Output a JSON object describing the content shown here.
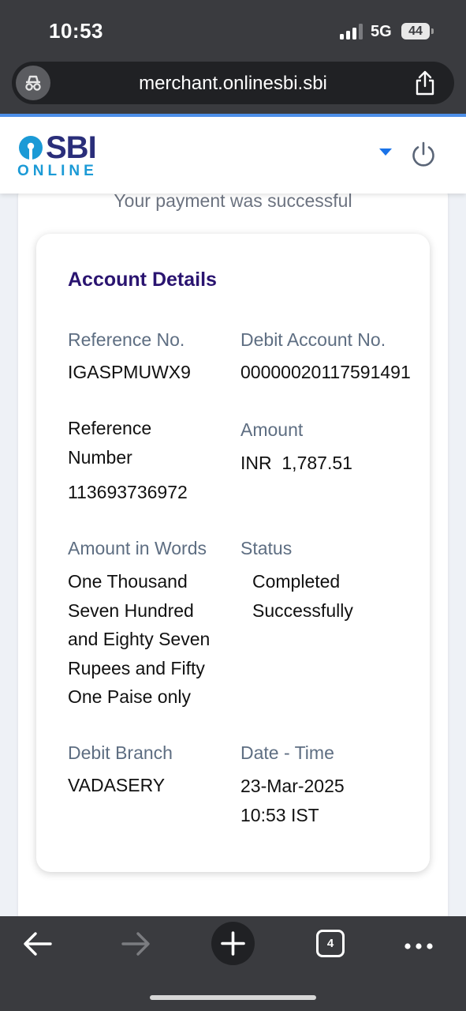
{
  "status_bar": {
    "time": "10:53",
    "network": "5G",
    "battery": "44"
  },
  "browser": {
    "url": "merchant.onlinesbi.sbi",
    "tab_count": "4"
  },
  "site_header": {
    "brand": "SBI",
    "brand_sub": "ONLINE"
  },
  "page": {
    "success_message": "Your payment was successful"
  },
  "account_details": {
    "title": "Account Details",
    "reference_no_label": "Reference No.",
    "reference_no_value": "IGASPMUWX9",
    "debit_account_label": "Debit Account No.",
    "debit_account_value": "00000020117591491",
    "reference_number_label_line1": "Reference",
    "reference_number_label_line2": "Number",
    "reference_number_value": "113693736972",
    "amount_label": "Amount",
    "amount_value": "INR  1,787.51",
    "amount_words_label": "Amount in Words",
    "amount_words_lines": [
      "One Thousand",
      "Seven Hundred",
      "and Eighty Seven",
      "Rupees and Fifty",
      "One Paise only"
    ],
    "status_label": "Status",
    "status_lines": [
      "Completed",
      "Successfully"
    ],
    "debit_branch_label": "Debit Branch",
    "debit_branch_value": "VADASERY",
    "date_time_label": "Date - Time",
    "date_time_lines": [
      "23-Mar-2025",
      "10:53 IST"
    ]
  },
  "colors": {
    "title": "#2a1470",
    "label": "#5e6e82",
    "brand_navy": "#2a2e7a",
    "brand_blue": "#1b9ad6",
    "link_blue": "#1a73e8"
  }
}
